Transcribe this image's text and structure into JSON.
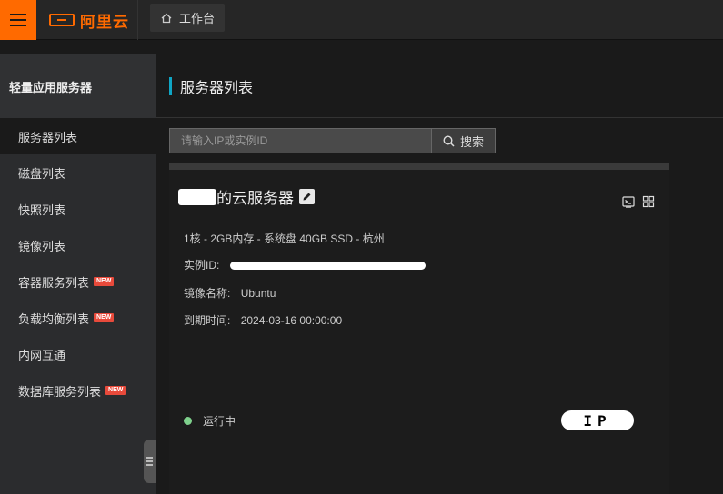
{
  "topbar": {
    "logo_text": "阿里云",
    "workbench_label": "工作台"
  },
  "sidebar": {
    "title": "轻量应用服务器",
    "items": [
      {
        "label": "服务器列表",
        "badge": ""
      },
      {
        "label": "磁盘列表",
        "badge": ""
      },
      {
        "label": "快照列表",
        "badge": ""
      },
      {
        "label": "镜像列表",
        "badge": ""
      },
      {
        "label": "容器服务列表",
        "badge": "NEW"
      },
      {
        "label": "负载均衡列表",
        "badge": "NEW"
      },
      {
        "label": "内网互通",
        "badge": ""
      },
      {
        "label": "数据库服务列表",
        "badge": "NEW"
      }
    ]
  },
  "main": {
    "page_title": "服务器列表",
    "search": {
      "placeholder": "请输入IP或实例ID",
      "button_label": "搜索"
    },
    "server": {
      "name_suffix": "的云服务器",
      "spec": "1核 - 2GB内存 - 系统盘 40GB SSD - 杭州",
      "instance_id_label": "实例ID:",
      "image_label": "镜像名称:",
      "image_value": "Ubuntu",
      "expire_label": "到期时间:",
      "expire_value": "2024-03-16 00:00:00",
      "status": "运行中",
      "ip_mark": "IP"
    }
  },
  "colors": {
    "accent": "#ff6a00",
    "title_bar": "#0fa5c4",
    "badge": "#e84a3b",
    "running": "#7ed08c"
  }
}
